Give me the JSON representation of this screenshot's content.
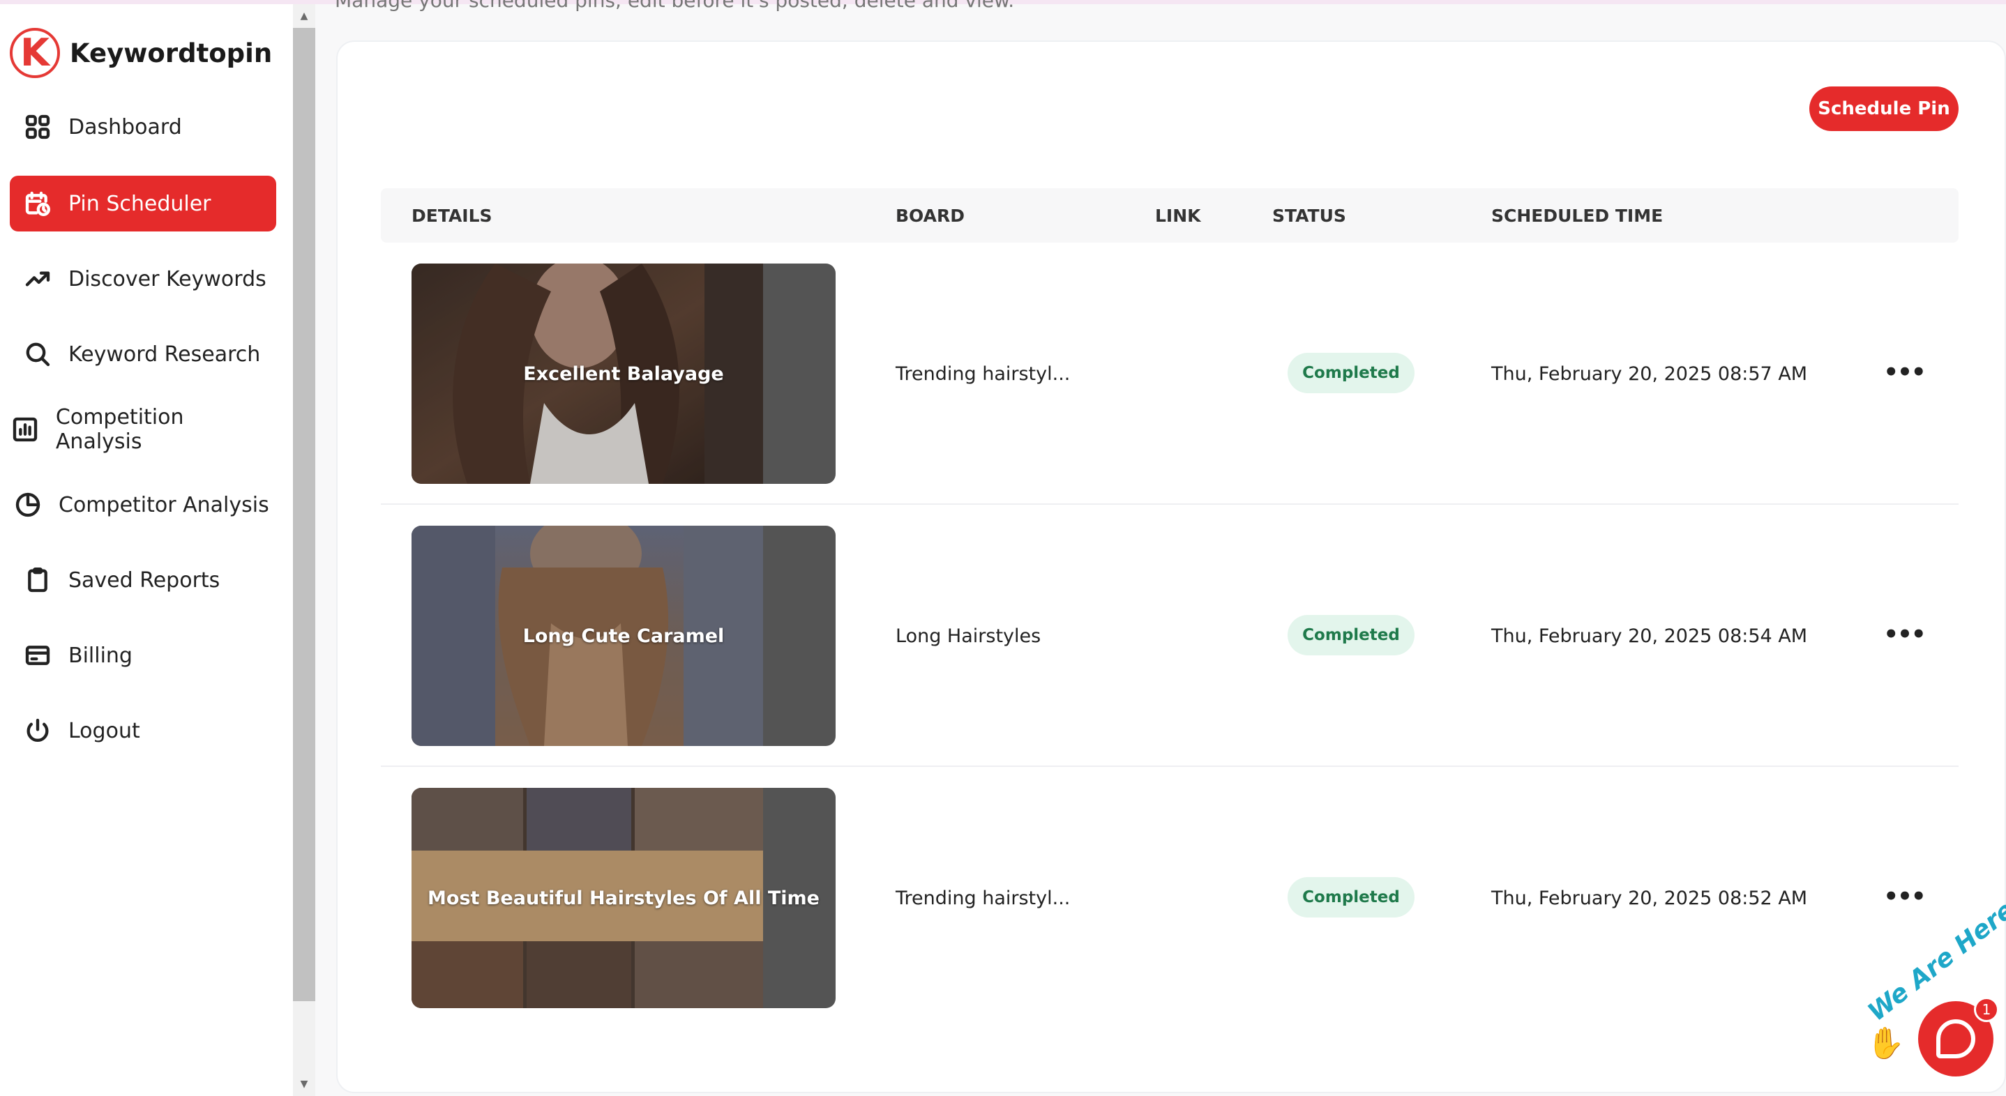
{
  "app": {
    "name": "Keywordtopin",
    "logo_letter": "K",
    "accent": "#e52b2b"
  },
  "page": {
    "subtitle": "Manage your scheduled pins, edit before it's posted, delete and view."
  },
  "sidebar": {
    "items": [
      {
        "label": "Dashboard",
        "icon": "grid-icon",
        "active": false
      },
      {
        "label": "Pin Scheduler",
        "icon": "calendar-clock-icon",
        "active": true
      },
      {
        "label": "Discover Keywords",
        "icon": "trending-up-icon",
        "active": false
      },
      {
        "label": "Keyword Research",
        "icon": "search-icon",
        "active": false
      },
      {
        "label": "Competition Analysis",
        "icon": "bar-chart-icon",
        "active": false
      },
      {
        "label": "Competitor Analysis",
        "icon": "pie-chart-icon",
        "active": false
      },
      {
        "label": "Saved Reports",
        "icon": "clipboard-icon",
        "active": false
      },
      {
        "label": "Billing",
        "icon": "credit-card-icon",
        "active": false
      },
      {
        "label": "Logout",
        "icon": "power-icon",
        "active": false
      }
    ]
  },
  "toolbar": {
    "schedule_label": "Schedule Pin"
  },
  "table": {
    "headers": {
      "details": "DETAILS",
      "board": "BOARD",
      "link": "LINK",
      "status": "STATUS",
      "time": "SCHEDULED TIME"
    },
    "rows": [
      {
        "title": "Excellent Balayage",
        "board": "Trending hairstyl...",
        "link": "",
        "status": "Completed",
        "time": "Thu, February 20, 2025 08:57 AM",
        "more": "•••"
      },
      {
        "title": "Long Cute Caramel",
        "board": "Long Hairstyles",
        "link": "",
        "status": "Completed",
        "time": "Thu, February 20, 2025 08:54 AM",
        "more": "•••"
      },
      {
        "title": "Most Beautiful Hairstyles Of All Time",
        "board": "Trending hairstyl...",
        "link": "",
        "status": "Completed",
        "time": "Thu, February 20, 2025 08:52 AM",
        "more": "•••"
      }
    ]
  },
  "chat": {
    "tagline": "We Are Here",
    "unread": "1"
  }
}
